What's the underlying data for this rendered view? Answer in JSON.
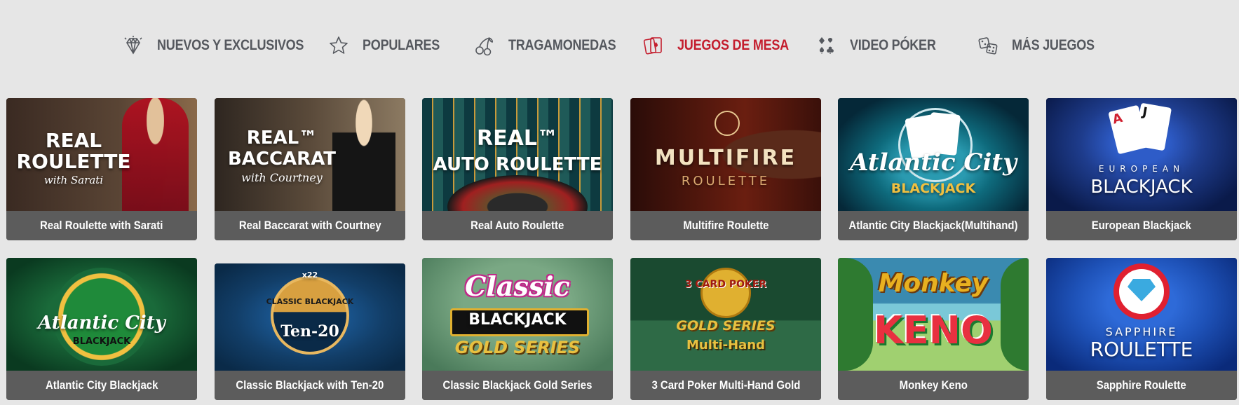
{
  "nav": {
    "items": [
      {
        "label": "NUEVOS Y EXCLUSIVOS",
        "icon": "diamond-icon",
        "active": false
      },
      {
        "label": "POPULARES",
        "icon": "star-icon",
        "active": false
      },
      {
        "label": "TRAGAMONEDAS",
        "icon": "cherries-icon",
        "active": false
      },
      {
        "label": "JUEGOS DE MESA",
        "icon": "playing-cards-icon",
        "active": true
      },
      {
        "label": "VIDEO PÓKER",
        "icon": "card-suits-icon",
        "active": false
      },
      {
        "label": "MÁS JUEGOS",
        "icon": "dice-icon",
        "active": false
      }
    ],
    "colors": {
      "inactive": "#55585e",
      "active": "#c41e2e"
    }
  },
  "games": [
    {
      "title": "Real Roulette with Sarati",
      "art": [
        "REAL",
        "ROULETTE",
        "with Sarati"
      ],
      "bg": [
        "#3a2a22",
        "#8a6a4a"
      ],
      "accent": "#b01020"
    },
    {
      "title": "Real Baccarat with Courtney",
      "art": [
        "REAL™",
        "BACCARAT",
        "with Courtney"
      ],
      "bg": [
        "#2e2620",
        "#8c7a62"
      ],
      "accent": "#1a1a1a"
    },
    {
      "title": "Real Auto Roulette",
      "art": [
        "REAL™",
        "AUTO ROULETTE",
        ""
      ],
      "bg": [
        "#0d3a40",
        "#1f5a58"
      ],
      "accent": "#c89a3a"
    },
    {
      "title": "Multifire Roulette",
      "art": [
        "",
        "MULTIFIRE",
        "ROULETTE"
      ],
      "bg": [
        "#2a0c08",
        "#6a1e10"
      ],
      "accent": "#e7c690"
    },
    {
      "title": "Atlantic City Blackjack(Multihand)",
      "art": [
        "",
        "Atlantic City",
        "BLACKJACK"
      ],
      "bg": [
        "#052838",
        "#0e6a7c"
      ],
      "accent": "#f0c040"
    },
    {
      "title": "European Blackjack",
      "art": [
        "",
        "EUROPEAN",
        "BLACKJACK"
      ],
      "bg": [
        "#0a1a4a",
        "#1e3c8c"
      ],
      "accent": "#ffffff"
    },
    {
      "title": "Atlantic City Blackjack",
      "art": [
        "",
        "Atlantic City",
        "BLACKJACK"
      ],
      "bg": [
        "#0a3a20",
        "#1a6a3a"
      ],
      "accent": "#f0c040"
    },
    {
      "title": "Classic Blackjack with Ten-20",
      "art": [
        "x22",
        "CLASSIC BLACKJACK",
        "Ten-20"
      ],
      "bg": [
        "#0a2a48",
        "#123e68"
      ],
      "accent": "#d8a040"
    },
    {
      "title": "Classic Blackjack Gold Series",
      "art": [
        "Classic",
        "BLACKJACK",
        "GOLD SERIES"
      ],
      "bg": [
        "#4a7a5a",
        "#7aa884"
      ],
      "accent": "#c02a8a"
    },
    {
      "title": "3 Card Poker Multi-Hand Gold",
      "art": [
        "3 CARD POKER",
        "GOLD SERIES",
        "Multi-Hand"
      ],
      "bg": [
        "#1a4a30",
        "#2e6a46"
      ],
      "accent": "#e0b030"
    },
    {
      "title": "Monkey Keno",
      "art": [
        "",
        "Monkey",
        "KENO"
      ],
      "bg": [
        "#3a8ab0",
        "#a0d070"
      ],
      "accent": "#e8b020"
    },
    {
      "title": "Sapphire Roulette",
      "art": [
        "",
        "SAPPHIRE",
        "ROULETTE"
      ],
      "bg": [
        "#0a2a7a",
        "#1e52b8"
      ],
      "accent": "#e02030"
    }
  ]
}
